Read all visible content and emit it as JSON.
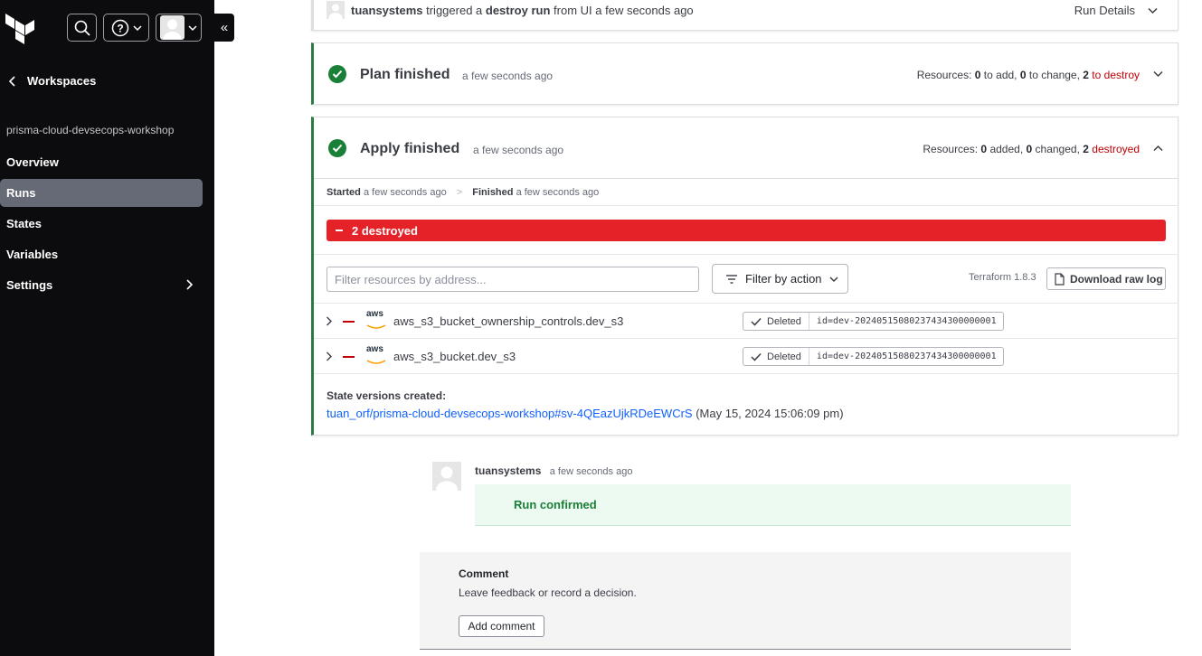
{
  "sidebar": {
    "back_label": "Workspaces",
    "workspace_name": "prisma-cloud-devsecops-workshop",
    "items": [
      {
        "label": "Overview"
      },
      {
        "label": "Runs"
      },
      {
        "label": "States"
      },
      {
        "label": "Variables"
      },
      {
        "label": "Settings"
      }
    ],
    "collapse_glyph": "«"
  },
  "trigger": {
    "user": "tuansystems",
    "text1": "triggered a",
    "run_type": "destroy run",
    "text2": "from UI a few seconds ago",
    "details_label": "Run Details"
  },
  "plan": {
    "title": "Plan finished",
    "time": "a few seconds ago",
    "res_prefix": "Resources:",
    "add": "0",
    "add_label": "to add,",
    "change": "0",
    "change_label": "to change,",
    "destroy": "2",
    "destroy_label": "to destroy"
  },
  "apply": {
    "title": "Apply finished",
    "time": "a few seconds ago",
    "res_prefix": "Resources:",
    "added": "0",
    "added_label": "added,",
    "changed": "0",
    "changed_label": "changed,",
    "destroyed": "2",
    "destroyed_label": "destroyed",
    "started_label": "Started",
    "started_time": "a few seconds ago",
    "sep": ">",
    "finished_label": "Finished",
    "finished_time": "a few seconds ago",
    "destroyed_bar": "2 destroyed",
    "filter_placeholder": "Filter resources by address...",
    "filter_action_label": "Filter by action",
    "terraform_version": "Terraform 1.8.3",
    "download_label": "Download raw log",
    "resources": [
      {
        "provider": "aws",
        "address": "aws_s3_bucket_ownership_controls.dev_s3",
        "status": "Deleted",
        "id": "id=dev-20240515080237434300000001"
      },
      {
        "provider": "aws",
        "address": "aws_s3_bucket.dev_s3",
        "status": "Deleted",
        "id": "id=dev-20240515080237434300000001"
      }
    ],
    "state_versions_label": "State versions created:",
    "state_link": "tuan_orf/prisma-cloud-devsecops-workshop#sv-4QEazUjkRDeEWCrS",
    "state_time": "(May 15, 2024 15:06:09 pm)"
  },
  "comment_thread": {
    "user": "tuansystems",
    "time": "a few seconds ago",
    "message": "Run confirmed"
  },
  "comment_form": {
    "title": "Comment",
    "hint": "Leave feedback or record a decision.",
    "button": "Add comment"
  },
  "colors": {
    "sidebar_bg": "#0c0c0e",
    "success": "#1a7f37",
    "danger": "#e52228",
    "link": "#1060ff"
  }
}
